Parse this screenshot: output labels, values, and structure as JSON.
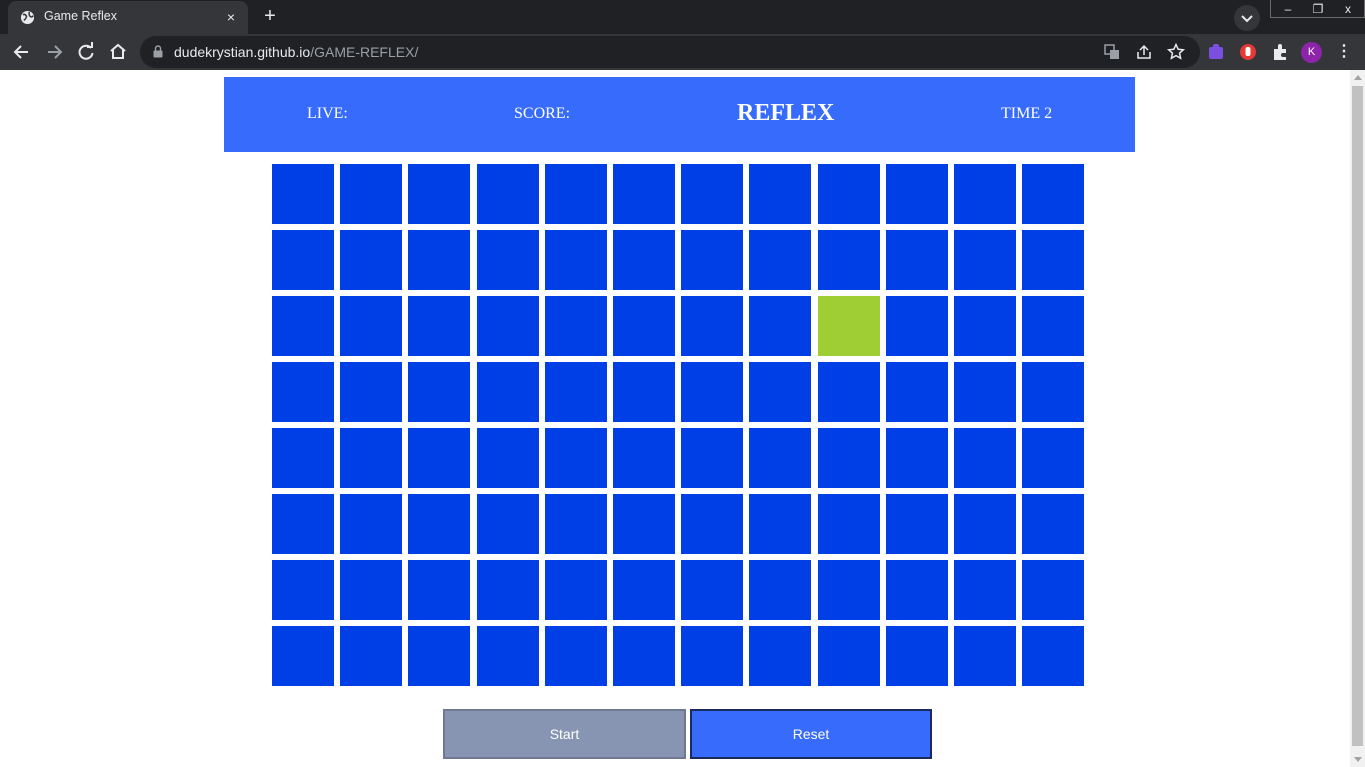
{
  "browser": {
    "tab": {
      "title": "Game Reflex",
      "favicon": "globe-icon",
      "close": "×"
    },
    "new_tab": "+",
    "address": {
      "host": "dudekrystian.github.io",
      "path": "/GAME-REFLEX/"
    },
    "profile_initial": "K",
    "window_controls": {
      "minimize": "–",
      "restore": "❐",
      "close": "x"
    }
  },
  "game": {
    "live_label": "LIVE:",
    "score_label": "SCORE:",
    "title": "REFLEX",
    "time_label": "TIME 2",
    "grid": {
      "rows": 8,
      "cols": 12,
      "active_cell": {
        "row": 3,
        "col": 9
      }
    },
    "colors": {
      "header": "#366bfb",
      "cell": "#003ee6",
      "active_cell": "#9ecd34"
    }
  },
  "controls": {
    "start_label": "Start",
    "reset_label": "Reset"
  }
}
